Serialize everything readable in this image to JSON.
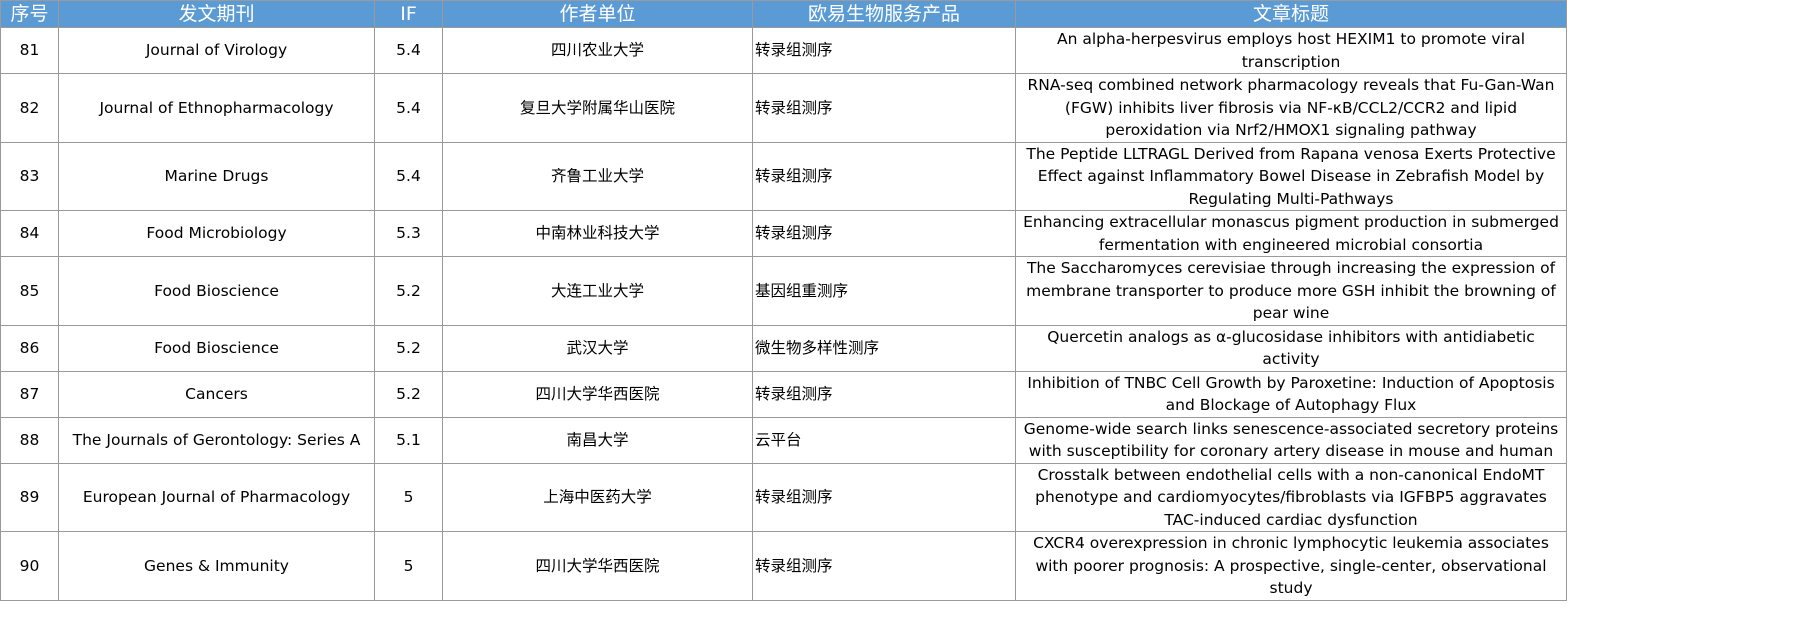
{
  "columns": [
    "序号",
    "发文期刊",
    "IF",
    "作者单位",
    "欧易生物服务产品",
    "文章标题"
  ],
  "rows": [
    {
      "no": "81",
      "journal": "Journal of Virology",
      "if": "5.4",
      "unit": "四川农业大学",
      "service": "转录组测序",
      "title": "An alpha-herpesvirus employs host HEXIM1 to promote viral transcription"
    },
    {
      "no": "82",
      "journal": "Journal of Ethnopharmacology",
      "if": "5.4",
      "unit": "复旦大学附属华山医院",
      "service": "转录组测序",
      "title": "RNA-seq combined network pharmacology reveals that Fu-Gan-Wan (FGW) inhibits liver fibrosis via NF-κB/CCL2/CCR2 and lipid peroxidation via Nrf2/HMOX1 signaling pathway"
    },
    {
      "no": "83",
      "journal": "Marine Drugs",
      "if": "5.4",
      "unit": "齐鲁工业大学",
      "service": "转录组测序",
      "title": "The Peptide LLTRAGL Derived from Rapana venosa Exerts Protective Effect against Inflammatory Bowel Disease in Zebrafish Model by Regulating Multi-Pathways"
    },
    {
      "no": "84",
      "journal": "Food Microbiology",
      "if": "5.3",
      "unit": "中南林业科技大学",
      "service": "转录组测序",
      "title": "Enhancing extracellular monascus pigment production in submerged fermentation with engineered microbial consortia"
    },
    {
      "no": "85",
      "journal": "Food Bioscience",
      "if": "5.2",
      "unit": "大连工业大学",
      "service": "基因组重测序",
      "title": "The Saccharomyces cerevisiae through increasing the expression of membrane transporter to produce more GSH inhibit the browning of pear wine"
    },
    {
      "no": "86",
      "journal": "Food Bioscience",
      "if": "5.2",
      "unit": "武汉大学",
      "service": "微生物多样性测序",
      "title": "Quercetin analogs as α-glucosidase inhibitors with antidiabetic activity"
    },
    {
      "no": "87",
      "journal": "Cancers",
      "if": "5.2",
      "unit": "四川大学华西医院",
      "service": "转录组测序",
      "title": "Inhibition of TNBC Cell Growth by Paroxetine: Induction of Apoptosis and Blockage of Autophagy Flux"
    },
    {
      "no": "88",
      "journal": "The Journals of Gerontology: Series A",
      "if": "5.1",
      "unit": "南昌大学",
      "service": "云平台",
      "title": "Genome-wide search links senescence-associated secretory proteins with susceptibility for coronary artery disease in mouse and human"
    },
    {
      "no": "89",
      "journal": "European Journal of Pharmacology",
      "if": "5",
      "unit": "上海中医药大学",
      "service": "转录组测序",
      "title": "Crosstalk between endothelial cells with a non-canonical EndoMT phenotype and cardiomyocytes/fibroblasts via IGFBP5 aggravates TAC-induced cardiac dysfunction"
    },
    {
      "no": "90",
      "journal": "Genes & Immunity",
      "if": "5",
      "unit": "四川大学华西医院",
      "service": "转录组测序",
      "title": "CXCR4 overexpression in chronic lymphocytic leukemia associates with poorer prognosis: A prospective, single-center, observational study"
    }
  ]
}
